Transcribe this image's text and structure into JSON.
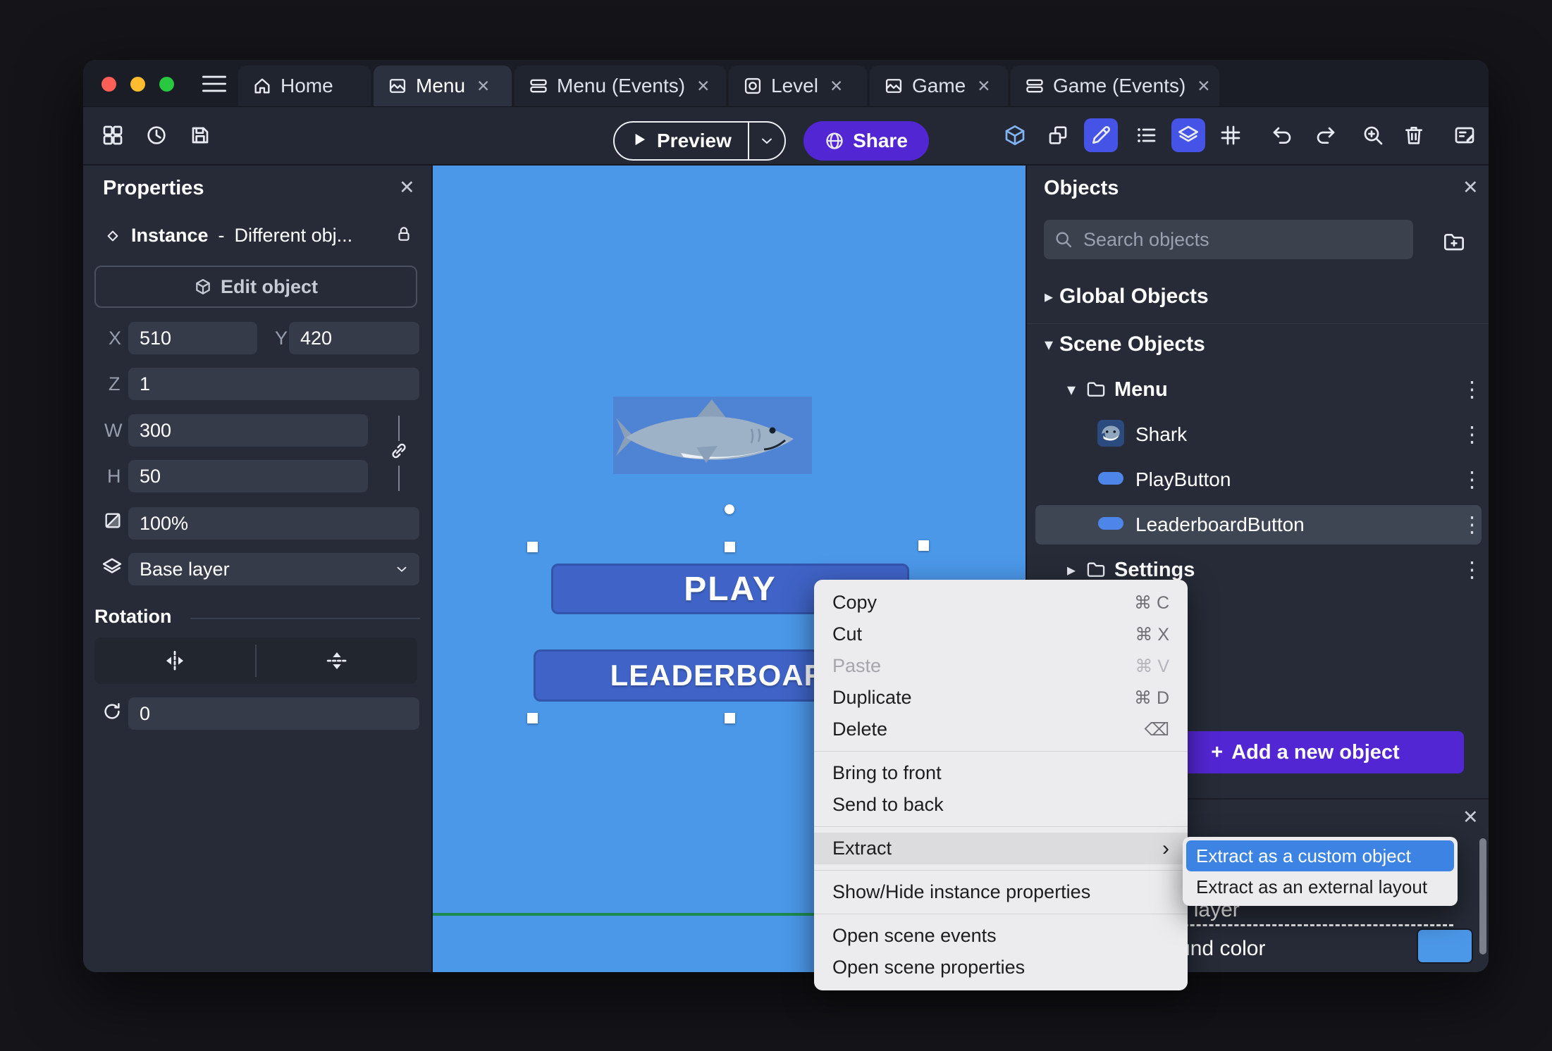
{
  "glyphs": {
    "close": "✕",
    "kebab": "⋮",
    "plus": "+",
    "caret_down": "▾",
    "caret_right": "▸",
    "submenu_arrow": "›"
  },
  "colors": {
    "canvas_blue": "#4b97e8",
    "accent_purple": "#5326d4",
    "submenu_highlight_blue": "#3c83e3",
    "active_tool_blue": "#4554e6",
    "scene_border_green": "#1b8a4e",
    "scene_button_blue": "#3f63c6"
  },
  "tabs": {
    "home": "Home",
    "menu": "Menu",
    "menu_events": "Menu (Events)",
    "level": "Level",
    "game": "Game",
    "game_events": "Game (Events)"
  },
  "toolbar": {
    "preview": "Preview",
    "share": "Share"
  },
  "properties": {
    "title": "Properties",
    "instance_label": "Instance",
    "dash": "-",
    "instance_value": "Different obj...",
    "edit_object": "Edit object",
    "x_label": "X",
    "x_value": "510",
    "y_label": "Y",
    "y_value": "420",
    "z_label": "Z",
    "z_value": "1",
    "w_label": "W",
    "w_value": "300",
    "h_label": "H",
    "h_value": "50",
    "opacity_value": "100%",
    "layer_value": "Base layer",
    "rotation_title": "Rotation",
    "rotation_value": "0"
  },
  "canvas": {
    "play": "PLAY",
    "leaderboard": "LEADERBOARD"
  },
  "context_menu": {
    "copy": "Copy",
    "copy_shortcut": "⌘ C",
    "cut": "Cut",
    "cut_shortcut": "⌘ X",
    "paste": "Paste",
    "paste_shortcut": "⌘ V",
    "duplicate": "Duplicate",
    "duplicate_shortcut": "⌘ D",
    "delete": "Delete",
    "delete_shortcut": "⌫",
    "bring_to_front": "Bring to front",
    "send_to_back": "Send to back",
    "extract": "Extract",
    "show_hide": "Show/Hide instance properties",
    "open_scene_events": "Open scene events",
    "open_scene_properties": "Open scene properties",
    "extract_custom": "Extract as a custom object",
    "extract_external": "Extract as an external layout"
  },
  "objects": {
    "title": "Objects",
    "search_placeholder": "Search objects",
    "global_objects": "Global Objects",
    "scene_objects": "Scene Objects",
    "menu_folder": "Menu",
    "shark": "Shark",
    "play_button": "PlayButton",
    "leaderboard_button": "LeaderboardButton",
    "settings_folder": "Settings",
    "add_new_object": "Add a new object"
  },
  "bottom_panel": {
    "layer_name": "Base layer",
    "background_color_label": "Background color"
  }
}
